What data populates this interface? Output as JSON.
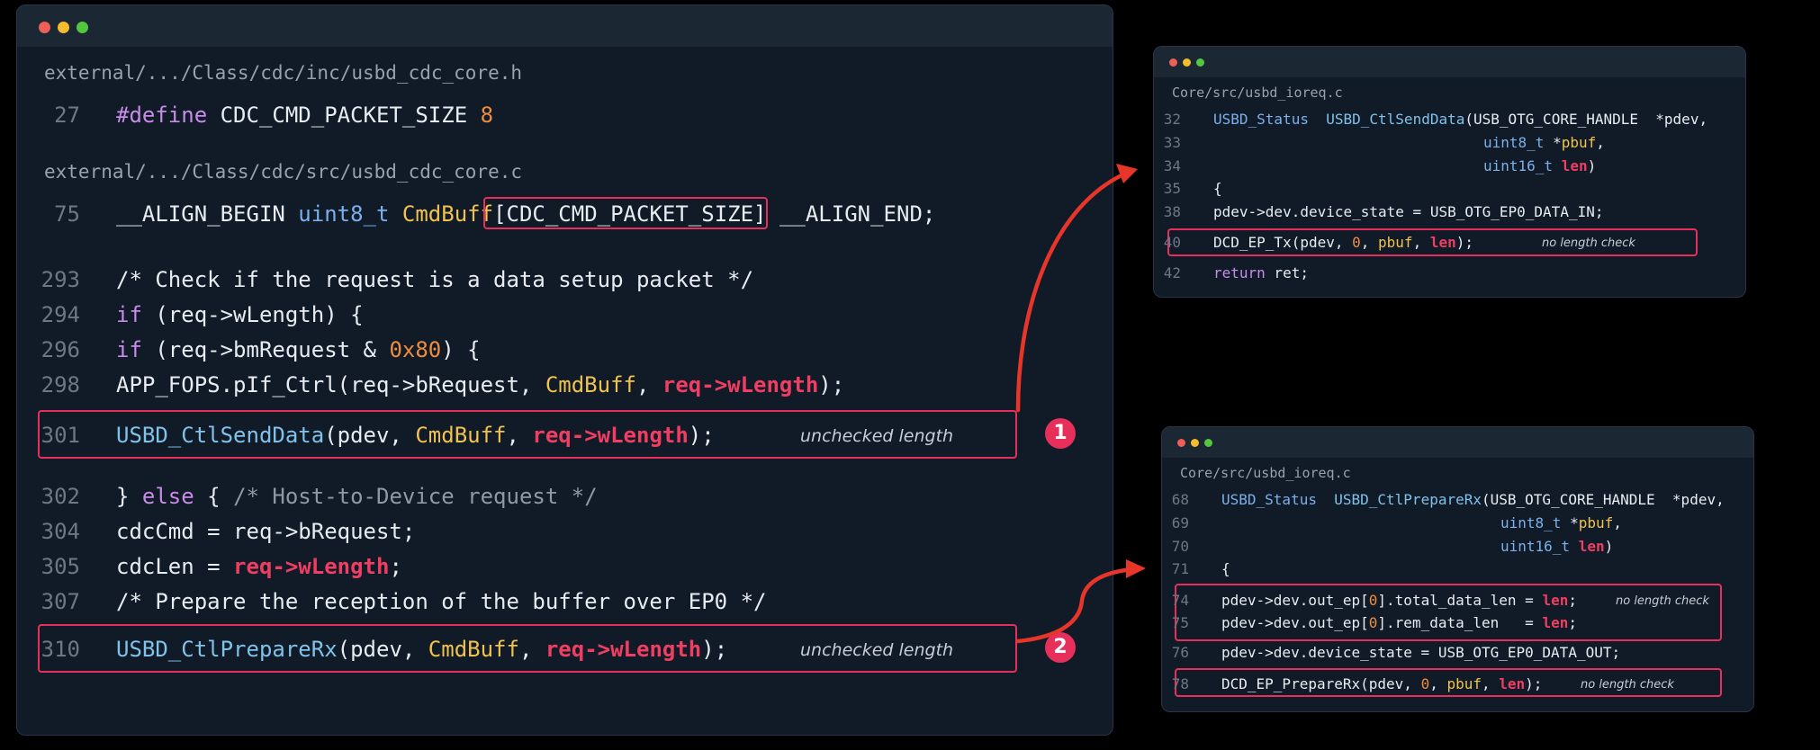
{
  "main_window": {
    "file1": "external/.../Class/cdc/inc/usbd_cdc_core.h",
    "file2": "external/.../Class/cdc/src/usbd_cdc_core.c",
    "line_numbers": [
      "27",
      "75",
      "293",
      "294",
      "296",
      "298",
      "301",
      "302",
      "304",
      "305",
      "307",
      "310"
    ],
    "code": {
      "l27_kw": "#define",
      "l27_name": " CDC_CMD_PACKET_SIZE ",
      "l27_num": "8",
      "l75_a": "__ALIGN_BEGIN ",
      "l75_type": "uint8_t",
      "l75_sp": " ",
      "l75_var": "CmdBuff",
      "l75_size": "[CDC_CMD_PACKET_SIZE]",
      "l75_end": " __ALIGN_END;",
      "l293": "/* Check if the request is a data setup packet */",
      "l294_kw": "if",
      "l294_rest": " (req->wLength) {",
      "l296_kw": "if",
      "l296_a": " (req->bmRequest & ",
      "l296_num": "0x80",
      "l296_b": ") {",
      "l298_a": "APP_FOPS.pIf_Ctrl(req->bRequest, ",
      "l298_var": "CmdBuff",
      "l298_c": ", ",
      "l298_len": "req->wLength",
      "l298_d": ");",
      "l301_fn": "USBD_CtlSendData",
      "l301_a": "(pdev, ",
      "l301_var": "CmdBuff",
      "l301_c": ", ",
      "l301_len": "req->wLength",
      "l301_d": ");",
      "l302_a": "} ",
      "l302_kw": "else",
      "l302_b": " { ",
      "l302_cm": "/* Host-to-Device request */",
      "l304": "cdcCmd = req->bRequest;",
      "l305_a": "cdcLen = ",
      "l305_len": "req->wLength",
      "l305_b": ";",
      "l307": "/* Prepare the reception of the buffer over EP0 */",
      "l310_fn": "USBD_CtlPrepareRx",
      "l310_a": "(pdev, ",
      "l310_var": "CmdBuff",
      "l310_c": ", ",
      "l310_len": "req->wLength",
      "l310_d": ");"
    },
    "note_301": "unchecked length",
    "note_310": "unchecked length"
  },
  "badges": [
    "1",
    "2"
  ],
  "send_window": {
    "file": "Core/src/usbd_ioreq.c",
    "line_numbers": [
      "32",
      "33",
      "34",
      "35",
      "38",
      "40",
      "42"
    ],
    "code": {
      "l32_type": "USBD_Status",
      "l32_gap": "  ",
      "l32_fn": "USBD_CtlSendData",
      "l32_rest": "(USB_OTG_CORE_HANDLE  *pdev,",
      "l33_type": "uint8_t",
      "l33_a": " *",
      "l33_var": "pbuf",
      "l33_b": ",",
      "l34_type": "uint16_t",
      "l34_a": " ",
      "l34_len": "len",
      "l34_b": ")",
      "l35": "{",
      "l38": "pdev->dev.device_state = USB_OTG_EP0_DATA_IN;",
      "l40_a": "DCD_EP_Tx(pdev, ",
      "l40_num": "0",
      "l40_c1": ", ",
      "l40_var": "pbuf",
      "l40_c2": ", ",
      "l40_len": "len",
      "l40_d": ");",
      "l42_kw": "return",
      "l42_rest": " ret;"
    },
    "note_40": "no length check"
  },
  "recv_window": {
    "file": "Core/src/usbd_ioreq.c",
    "line_numbers": [
      "68",
      "69",
      "70",
      "71",
      "74",
      "75",
      "76",
      "78"
    ],
    "code": {
      "l68_type": "USBD_Status",
      "l68_gap": "  ",
      "l68_fn": "USBD_CtlPrepareRx",
      "l68_rest": "(USB_OTG_CORE_HANDLE  *pdev,",
      "l69_type": "uint8_t",
      "l69_a": " *",
      "l69_var": "pbuf",
      "l69_b": ",",
      "l70_type": "uint16_t",
      "l70_a": " ",
      "l70_len": "len",
      "l70_b": ")",
      "l71": "{",
      "l74_a": "pdev->dev.out_ep[",
      "l74_num": "0",
      "l74_b": "].total_data_len = ",
      "l74_len": "len",
      "l74_c": ";",
      "l75_a": "pdev->dev.out_ep[",
      "l75_num": "0",
      "l75_b": "].rem_data_len   = ",
      "l75_len": "len",
      "l75_c": ";",
      "l76": "pdev->dev.device_state = USB_OTG_EP0_DATA_OUT;",
      "l78_a": "DCD_EP_PrepareRx(pdev, ",
      "l78_num": "0",
      "l78_c1": ", ",
      "l78_var": "pbuf",
      "l78_c2": ", ",
      "l78_len": "len",
      "l78_d": ");"
    },
    "note_74": "no length check",
    "note_78": "no length check"
  },
  "colors": {
    "background": "#000000",
    "window": "#111a27",
    "highlight": "#e6305b",
    "arrow": "#e8352a",
    "keyword": "#c78ce8",
    "type": "#7cb0ec",
    "name": "#f0c24e",
    "number": "#ef8d3f",
    "danger": "#f03e63",
    "comment": "#8f99a6"
  }
}
